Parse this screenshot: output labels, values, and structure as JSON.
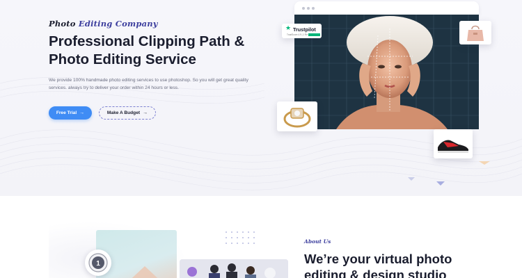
{
  "hero": {
    "eyebrow_word1": "Photo",
    "eyebrow_word2": "Editing Company",
    "headline_line1": "Professional Clipping Path &",
    "headline_line2": "Photo Editing Service",
    "description": "We provide 100% handmade photo editing services to use photoshop. So you will get great quality services. always try to deliver your order within 24 hours or less.",
    "primary_button": "Free Trial",
    "secondary_button": "Make A Budget",
    "arrow_icon": "→"
  },
  "trustpilot": {
    "name": "Trustpilot",
    "small_text": "TrustScore 4.9 | 1 Reviews"
  },
  "badge": {
    "number": "1"
  },
  "about": {
    "eyebrow": "About Us",
    "title_line1": "We’re your virtual photo",
    "title_line2": "editing & design studio"
  },
  "colors": {
    "brand_indigo": "#3d3f9e",
    "primary_blue": "#3f8cf5",
    "heading": "#1a1d2e",
    "panel_dark": "#1e3342",
    "trustpilot_green": "#00b67a"
  },
  "icons": [
    "arrow-right-icon",
    "trustpilot-star-icon",
    "bag-product-icon",
    "ring-product-icon",
    "shoe-product-icon",
    "award-badge-icon"
  ]
}
